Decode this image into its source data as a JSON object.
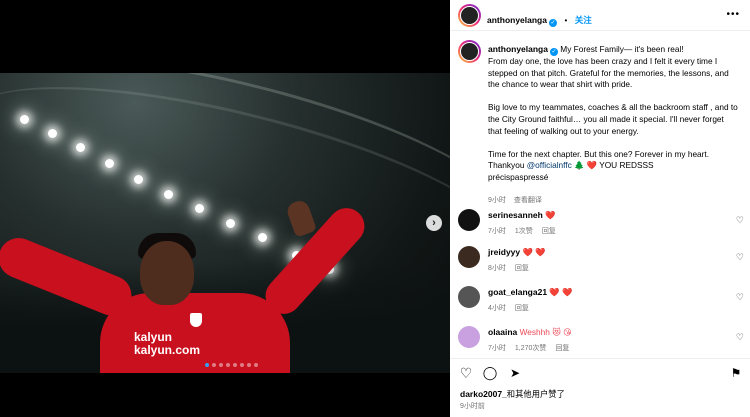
{
  "media": {
    "sponsor_text": "kalyun\nkalyun.com",
    "next_glyph": "›",
    "dot_count": 8,
    "active_dot": 0
  },
  "header": {
    "username": "anthonyelanga",
    "verified_glyph": "✓",
    "separator": "•",
    "follow_label": "关注",
    "more_glyph": "•••"
  },
  "post": {
    "username": "anthonyelanga",
    "first_line": "My Forest Family— it's been real!",
    "para1": "From day one, the love has been crazy and I felt it every time I stepped on that pitch. Grateful for the memories, the lessons, and the chance to wear that shirt with pride.",
    "para2": "Big love to my teammates, coaches & all the backroom staff , and to the City Ground faithful… you all made it special. I'll never forget that feeling of walking out to your energy.",
    "para3_a": "Time for the next chapter. But this one? Forever in my heart. Thankyou ",
    "para3_mention": "@officialnffc",
    "para3_b": " 🌲 ❤️ YOU REDSSS",
    "para3_c": "précispaspressé",
    "time": "9小时",
    "translate": "查看翻译"
  },
  "comments": [
    {
      "username": "serinesanneh",
      "text": "❤️",
      "time": "7小时",
      "likes": "1次赞",
      "reply": "回复",
      "avatar": "#111"
    },
    {
      "username": "jreidyyy",
      "text": "❤️ ❤️",
      "time": "8小时",
      "likes": "",
      "reply": "回复",
      "avatar": "#3a2a20"
    },
    {
      "username": "goat_elanga21",
      "text": "❤️ ❤️",
      "time": "4小时",
      "likes": "",
      "reply": "回复",
      "avatar": "#555"
    },
    {
      "username": "olaaina",
      "text": "Weshhh 😻 😘",
      "time": "7小时",
      "likes": "1,270次赞",
      "reply": "回复",
      "avatar": "#c9a0e0"
    }
  ],
  "actions": {
    "like_glyph": "♡",
    "comment_glyph": "◯",
    "share_glyph": "➤",
    "save_glyph": "⚑"
  },
  "likes_line": {
    "user": "darko2007_",
    "rest": "和其他用户赞了"
  },
  "posted_ago": "9小时前"
}
